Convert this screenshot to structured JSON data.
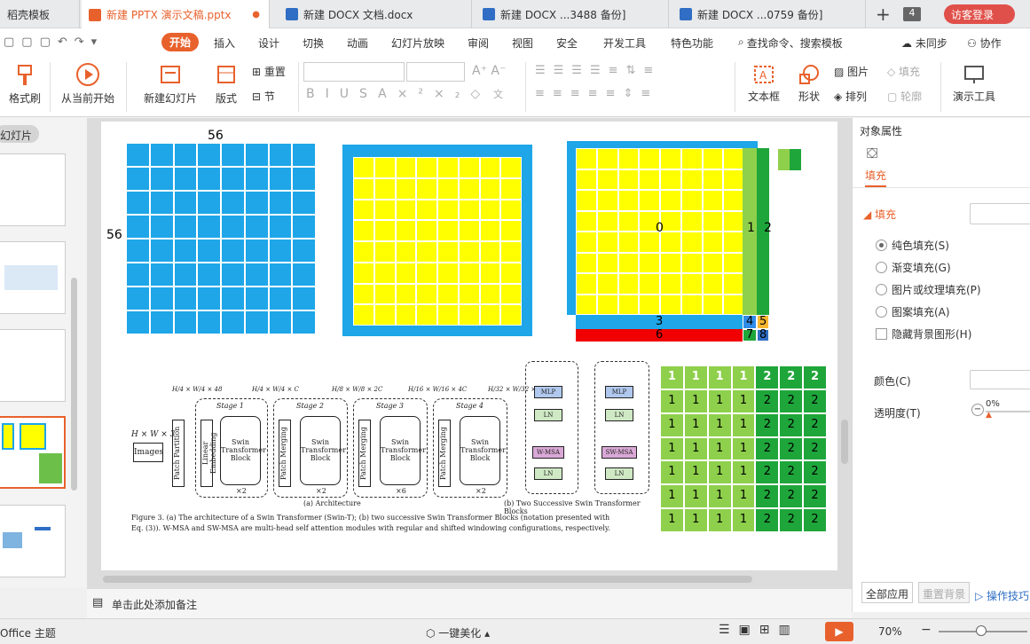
{
  "tabs": [
    {
      "label": "稻壳模板",
      "color": "#e24a2a"
    },
    {
      "label": "新建 PPTX 演示文稿.pptx",
      "color": "#e8612c"
    },
    {
      "label": "新建 DOCX 文档.docx",
      "color": "#2f6ec4"
    },
    {
      "label": "新建 DOCX ...3488 备份]",
      "color": "#2f6ec4"
    },
    {
      "label": "新建 DOCX ...0759 备份]",
      "color": "#2f6ec4"
    }
  ],
  "tab_count": "4",
  "login_label": "访客登录",
  "menu": {
    "items": [
      "开始",
      "插入",
      "设计",
      "切换",
      "动画",
      "幻灯片放映",
      "审阅",
      "视图",
      "安全",
      "开发工具",
      "特色功能"
    ],
    "search": "查找命令、搜索模板",
    "sync": "未同步",
    "collab": "协作"
  },
  "ribbon": {
    "format_painter": "格式刷",
    "play_from": "从当前开始",
    "new_slide": "新建幻灯片",
    "layout": "版式",
    "reset": "重置",
    "section": "节",
    "textbox": "文本框",
    "shape": "形状",
    "picture": "图片",
    "fill": "填充",
    "arrange": "排列",
    "outline": "轮廓",
    "present_tool": "演示工具"
  },
  "left_panel": {
    "title": "幻灯片"
  },
  "slide": {
    "label_56_top": "56",
    "label_56_left": "56",
    "region_labels": [
      "0",
      "1",
      "2",
      "3",
      "4",
      "5",
      "6",
      "7",
      "8"
    ],
    "caption_line1": "Figure 3. (a) The architecture of a Swin Transformer (Swin-T); (b) two successive Swin Transformer Blocks (notation presented with",
    "caption_line2": "Eq. (3)). W-MSA and SW-MSA are multi-head self attention modules with regular and shifted windowing configurations, respectively.",
    "arch_label": "(a) Architecture",
    "blocks_label": "(b) Two Successive Swin Transformer Blocks",
    "images": "Images",
    "input_dims": "H × W × 3",
    "patch_partition": "Patch Partition",
    "linear_embedding": "Linear Embedding",
    "patch_merging": "Patch Merging",
    "swin_block": "Swin Transformer Block",
    "stages": [
      "Stage 1",
      "Stage 2",
      "Stage 3",
      "Stage 4"
    ],
    "dims": [
      "H/4 × W/4 × 48",
      "H/4 × W/4 × C",
      "H/8 × W/8 × 2C",
      "H/16 × W/16 × 4C",
      "H/32 × W/32 × 8C"
    ],
    "repeats": [
      "×2",
      "×2",
      "×6",
      "×2"
    ],
    "mlp": "MLP",
    "ln": "LN",
    "wmsa": "W-MSA",
    "swmsa": "SW-MSA",
    "mask_header": [
      "1",
      "1",
      "1",
      "1",
      "2",
      "2",
      "2"
    ],
    "mask_row": [
      "1",
      "1",
      "1",
      "1",
      "2",
      "2",
      "2"
    ]
  },
  "right_panel": {
    "title": "对象属性",
    "tab": "填充",
    "section": "填充",
    "options": [
      "纯色填充(S)",
      "渐变填充(G)",
      "图片或纹理填充(P)",
      "图案填充(A)"
    ],
    "hide_bg": "隐藏背景图形(H)",
    "color_label": "颜色(C)",
    "transparency_label": "透明度(T)",
    "transparency_value": "0%",
    "apply_all": "全部应用",
    "reset_bg": "重置背景",
    "tips": "操作技巧"
  },
  "notes_placeholder": "单击此处添加备注",
  "status": {
    "theme": "Office 主题",
    "beautify": "一键美化",
    "zoom": "70%"
  },
  "colors": {
    "accent": "#e8612c",
    "blue": "#1ea6e8",
    "yellow": "#ffff00",
    "green_light": "#8ed04b",
    "green_dark": "#1fa63b",
    "red": "#f00000"
  }
}
